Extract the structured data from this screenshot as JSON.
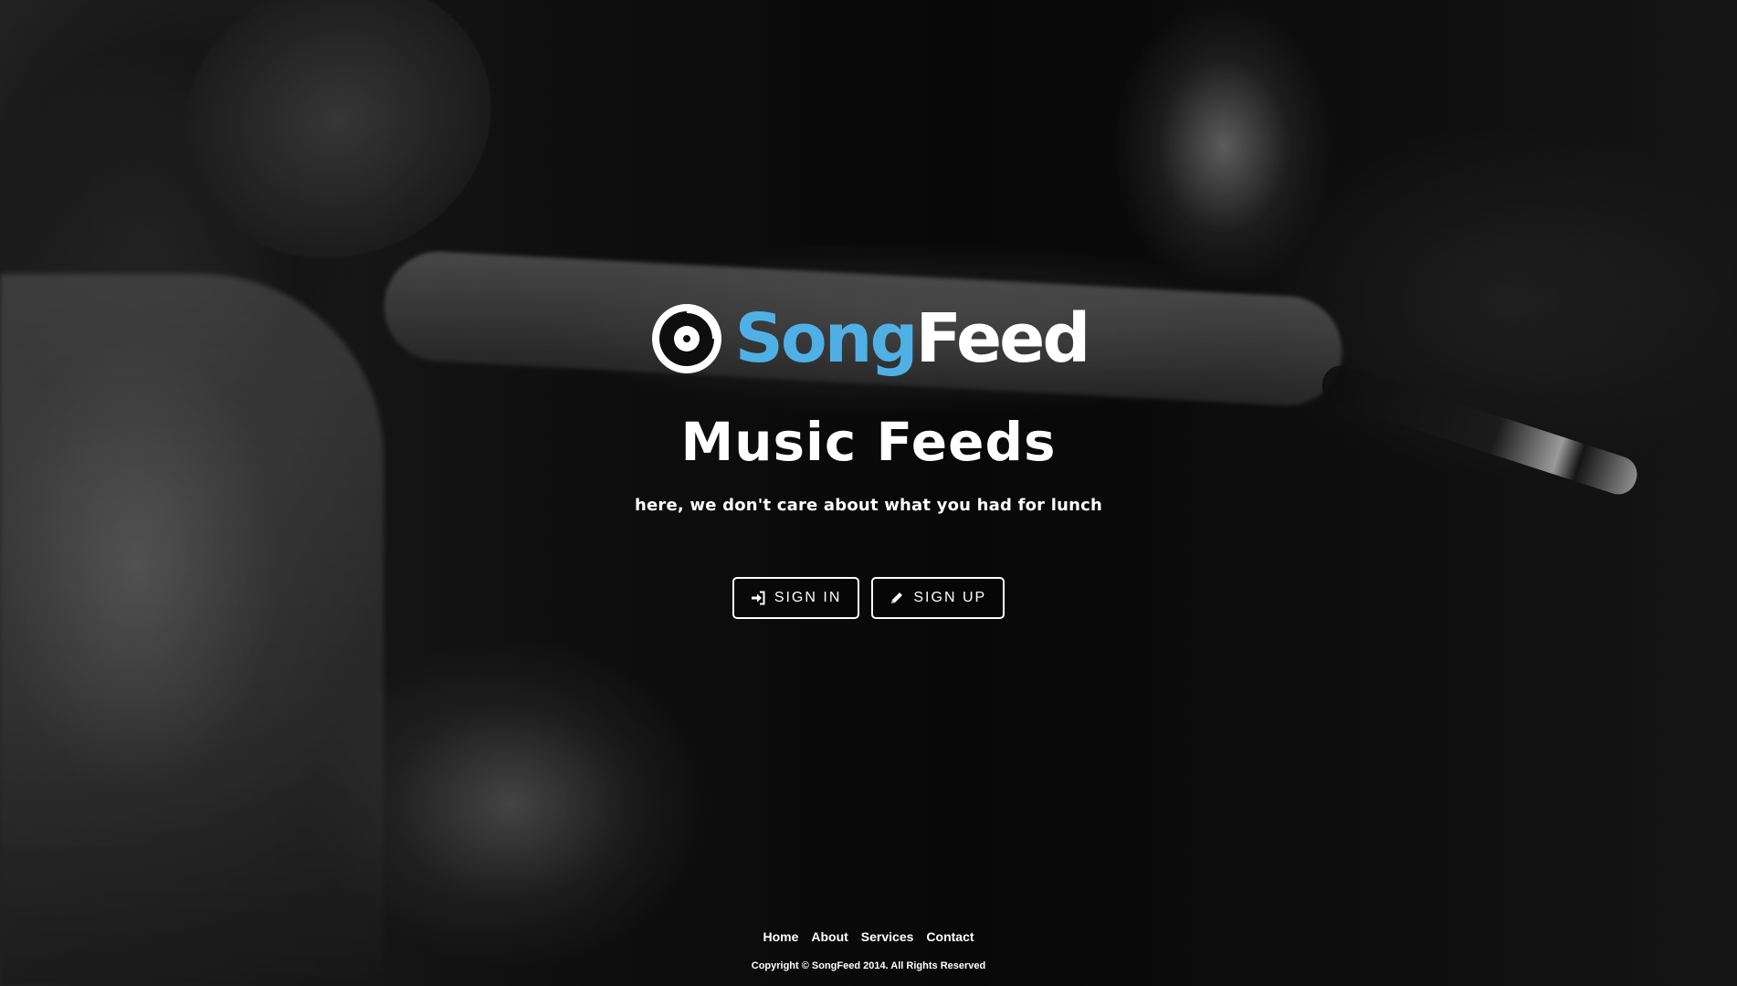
{
  "brand": {
    "name_part1": "Song",
    "name_part2": "Feed",
    "accent_color": "#4fb0e6",
    "logo_icon": "vinyl-disc-icon"
  },
  "hero": {
    "title": "Music Feeds",
    "tagline": "here, we don't care about what you had for lunch"
  },
  "actions": {
    "sign_in": {
      "label": "SIGN IN",
      "icon": "sign-in-icon"
    },
    "sign_up": {
      "label": "SIGN UP",
      "icon": "pencil-icon"
    }
  },
  "footer": {
    "nav": [
      {
        "label": "Home"
      },
      {
        "label": "About"
      },
      {
        "label": "Services"
      },
      {
        "label": "Contact"
      }
    ],
    "copyright": "Copyright © SongFeed 2014. All Rights Reserved"
  }
}
